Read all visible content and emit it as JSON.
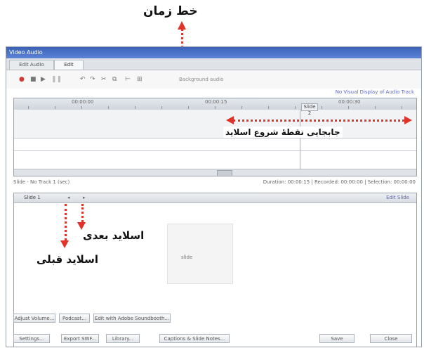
{
  "annotations": {
    "timeline_line": "خط زمان",
    "move_slide_start": "جابجایی نقطهٔ شروع اسلاید",
    "next_slide": "اسلاید بعدی",
    "previous_slide": "اسلاید قبلی",
    "color": "#e0332a"
  },
  "window": {
    "title": "Video Audio",
    "tabs": [
      "Edit Audio",
      "Edit"
    ],
    "active_tab": 1
  },
  "toolbar": {
    "buttons": [
      "record",
      "stop",
      "play",
      "pause",
      "undo",
      "redo",
      "cut",
      "copy",
      "split",
      "insert-silence"
    ],
    "track_label": "Background audio",
    "link_text": "No Visual Display of Audio Track"
  },
  "timeline": {
    "ruler_labels": [
      "00:00:00",
      "00:00:15",
      "00:00:30"
    ],
    "marker_label": "Slide 2"
  },
  "statusbar": {
    "left_text": "Slide - No Track 1 (sec)",
    "right_text": "Duration: 00:00:15 | Recorded: 00:00:00 | Selection: 00:00:00"
  },
  "slide_panel": {
    "slide_label": "Slide 1",
    "edit_link": "Edit Slide",
    "preview_text": "slide"
  },
  "bottom_buttons_row1": [
    "Adjust Volume...",
    "Podcast...",
    "Edit with Adobe Soundbooth..."
  ],
  "bottom_buttons_row2": [
    "Settings...",
    "Export SWF...",
    "Library...",
    "Captions & Slide Notes...",
    "Save",
    "Close"
  ]
}
